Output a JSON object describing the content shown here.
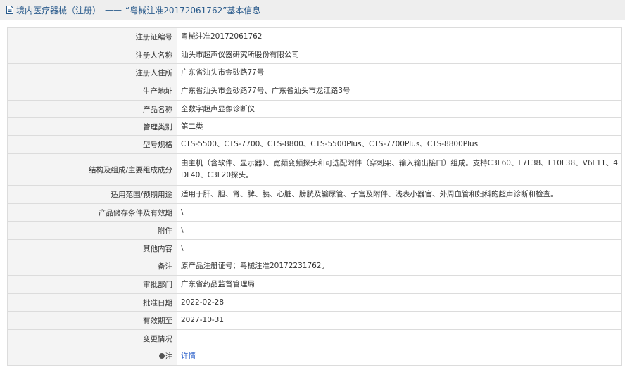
{
  "header": {
    "category": "境内医疗器械（注册）",
    "separator": "——",
    "title": "“粤械注准20172061762”基本信息"
  },
  "rows": [
    {
      "label": "注册证编号",
      "value": "粤械注准20172061762"
    },
    {
      "label": "注册人名称",
      "value": "汕头市超声仪器研究所股份有限公司"
    },
    {
      "label": "注册人住所",
      "value": "广东省汕头市金砂路77号"
    },
    {
      "label": "生产地址",
      "value": "广东省汕头市金砂路77号、广东省汕头市龙江路3号"
    },
    {
      "label": "产品名称",
      "value": "全数字超声显像诊断仪"
    },
    {
      "label": "管理类别",
      "value": "第二类"
    },
    {
      "label": "型号规格",
      "value": "CTS-5500、CTS-7700、CTS-8800、CTS-5500Plus、CTS-7700Plus、CTS-8800Plus"
    },
    {
      "label": "结构及组成/主要组成成分",
      "value": "由主机（含软件、显示器）、宽频变频探头和可选配附件（穿刺架、输入输出接口）组成。支持C3L60、L7L38、L10L38、V6L11、4DL40、C3L20探头。"
    },
    {
      "label": "适用范围/预期用途",
      "value": "适用于肝、胆、肾、脾、胰、心脏、膀胱及输尿管、子宫及附件、浅表小器官、外周血管和妇科的超声诊断和检查。"
    },
    {
      "label": "产品储存条件及有效期",
      "value": "\\"
    },
    {
      "label": "附件",
      "value": "\\"
    },
    {
      "label": "其他内容",
      "value": "\\"
    },
    {
      "label": "备注",
      "value": "原产品注册证号：粤械注准20172231762。"
    },
    {
      "label": "审批部门",
      "value": "广东省药品监督管理局"
    },
    {
      "label": "批准日期",
      "value": "2022-02-28"
    },
    {
      "label": "有效期至",
      "value": "2027-10-31"
    },
    {
      "label": "变更情况",
      "value": ""
    },
    {
      "label": "注",
      "value": "详情"
    }
  ]
}
